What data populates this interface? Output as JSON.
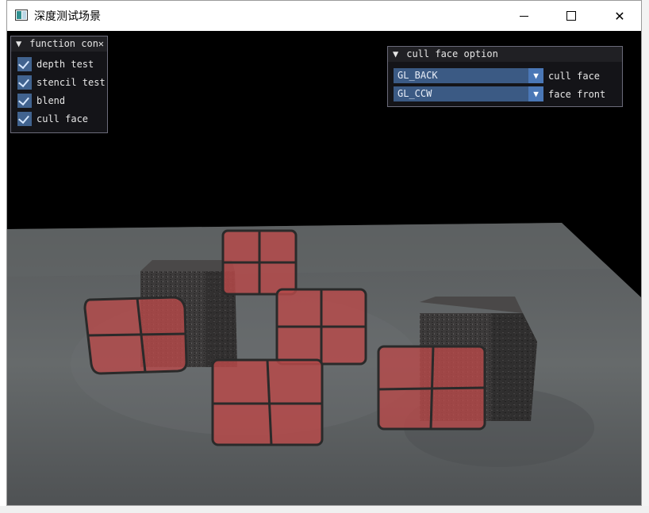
{
  "window": {
    "title": "深度测试场景",
    "minimize_glyph": "",
    "close_glyph": "✕"
  },
  "function_panel": {
    "title": "function con",
    "close_glyph": "✕",
    "collapse_glyph": "▼",
    "items": [
      {
        "label": "depth test",
        "checked": true
      },
      {
        "label": "stencil test",
        "checked": true
      },
      {
        "label": "blend",
        "checked": true
      },
      {
        "label": "cull face",
        "checked": true
      }
    ]
  },
  "cull_panel": {
    "title": "cull face option",
    "collapse_glyph": "▼",
    "combos": [
      {
        "value": "GL_BACK",
        "label": "cull face"
      },
      {
        "value": "GL_CCW",
        "label": "face front"
      }
    ],
    "arrow_glyph": "▼"
  },
  "colors": {
    "accent": "#41638f",
    "combo_bg": "#3b5a84",
    "window_bg": "#000000",
    "floor": "#5a5d5f",
    "glass_red": "#b84a4a",
    "cube_dark": "#3a3838"
  }
}
